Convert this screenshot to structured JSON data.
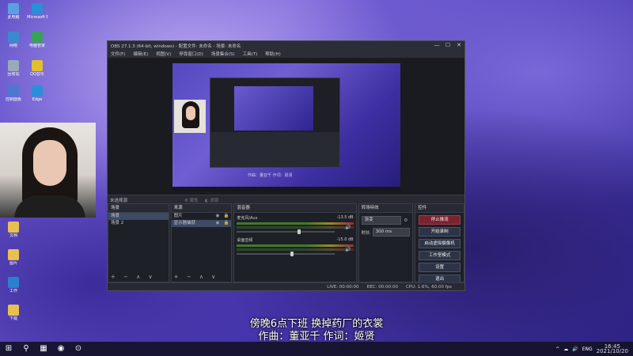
{
  "desktop": {
    "icons": [
      {
        "label": "此电脑",
        "color": "#5aa0e0"
      },
      {
        "label": "Microsoft Edge",
        "color": "#2a8fd8"
      },
      {
        "label": "网络",
        "color": "#3b8ad0"
      },
      {
        "label": "电脑管家",
        "color": "#3aa05a"
      },
      {
        "label": "回收站",
        "color": "#9ab"
      },
      {
        "label": "QQ音乐",
        "color": "#e0c030"
      },
      {
        "label": "控制面板",
        "color": "#4a7ad0"
      },
      {
        "label": "Edge",
        "color": "#2a8fd8"
      },
      {
        "label": "文档",
        "color": "#e8c050"
      },
      {
        "label": "图片",
        "color": "#e8c050"
      },
      {
        "label": "工作",
        "color": "#2a80d0"
      },
      {
        "label": "下载",
        "color": "#e8c050"
      }
    ]
  },
  "obs": {
    "title": "OBS 27.1.3 (64-bit, windows) - 配置文件: 未命名 - 场景: 未命名",
    "menu": [
      "文件(F)",
      "编辑(E)",
      "视图(V)",
      "停靠窗口(D)",
      "场景集合(S)",
      "工具(T)",
      "帮助(H)"
    ],
    "preview_caption": "作曲：董亚千 作词：姬贤",
    "status_left": "未选择源",
    "status_props": "⚙ 属性",
    "status_filters": "◐ 滤镜",
    "scenes": {
      "header": "场景",
      "items": [
        "场景",
        "场景 2"
      ],
      "selected": 0
    },
    "sources": {
      "header": "来源",
      "items": [
        "图片",
        "显示器捕获"
      ],
      "selected": 1
    },
    "mixer": {
      "header": "混音器",
      "channels": [
        {
          "name": "麦克风/Aux",
          "db": "-13.5 dB",
          "level": 0.62
        },
        {
          "name": "桌面音频",
          "db": "-15.0 dB",
          "level": 0.55
        }
      ]
    },
    "transitions": {
      "header": "转场特效",
      "type": "渐变",
      "duration_label": "时长",
      "duration": "300 ms"
    },
    "controls": {
      "header": "控件",
      "buttons": [
        "停止推流",
        "开始录制",
        "启动虚拟摄像机",
        "工作室模式",
        "设置",
        "退出"
      ]
    },
    "statusbar": {
      "live": "LIVE: 00:00:00",
      "rec": "REC: 00:00:00",
      "cpu": "CPU: 1.6%, 60.00 fps"
    },
    "winbtns": [
      "—",
      "☐",
      "✕"
    ],
    "dock_footer": "+ − ∧ ∨"
  },
  "lyrics": {
    "line1": "傍晚6点下班 换掉药厂的衣裳",
    "line2": "作曲：董亚千 作词：姬贤"
  },
  "taskbar": {
    "start": "⊞",
    "search": "⚲",
    "apps": [
      "▦",
      "◉",
      "⊙"
    ],
    "tray": [
      "^",
      "☁",
      "🔊",
      "ENG"
    ],
    "time": "16:45",
    "date": "2021/10/20"
  }
}
